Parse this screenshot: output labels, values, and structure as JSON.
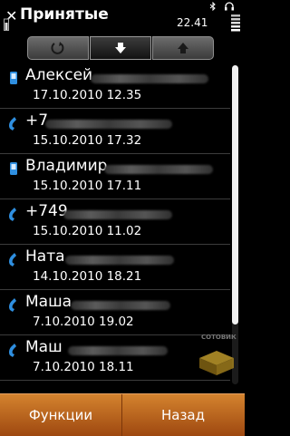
{
  "status": {
    "title": "Принятые",
    "time": "22.41"
  },
  "tabs": [
    {
      "icon": "incoming-call-icon"
    },
    {
      "icon": "download-arrow-icon",
      "active": true
    },
    {
      "icon": "upload-arrow-icon"
    }
  ],
  "calls": [
    {
      "name": "Алексей",
      "time": "17.10.2010 12.35",
      "icon": "mobile-phone-icon"
    },
    {
      "name": "+7",
      "time": "15.10.2010 17.32",
      "icon": "handset-icon"
    },
    {
      "name": "Владимир",
      "time": "15.10.2010 17.11",
      "icon": "mobile-phone-icon"
    },
    {
      "name": "+749",
      "time": "15.10.2010 11.02",
      "icon": "handset-icon"
    },
    {
      "name": "Ната",
      "time": "14.10.2010 18.21",
      "icon": "handset-icon"
    },
    {
      "name": "Маша",
      "time": "7.10.2010 19.02",
      "icon": "handset-icon"
    },
    {
      "name": "Маш",
      "time": "7.10.2010 18.11",
      "icon": "handset-icon"
    }
  ],
  "softkeys": {
    "left_label": "Функции",
    "right_label": "Назад"
  },
  "watermark": {
    "text": "СОТОВИК"
  },
  "colors": {
    "softkey_bar": "#c16a24",
    "accent": "#2f8fe0"
  }
}
